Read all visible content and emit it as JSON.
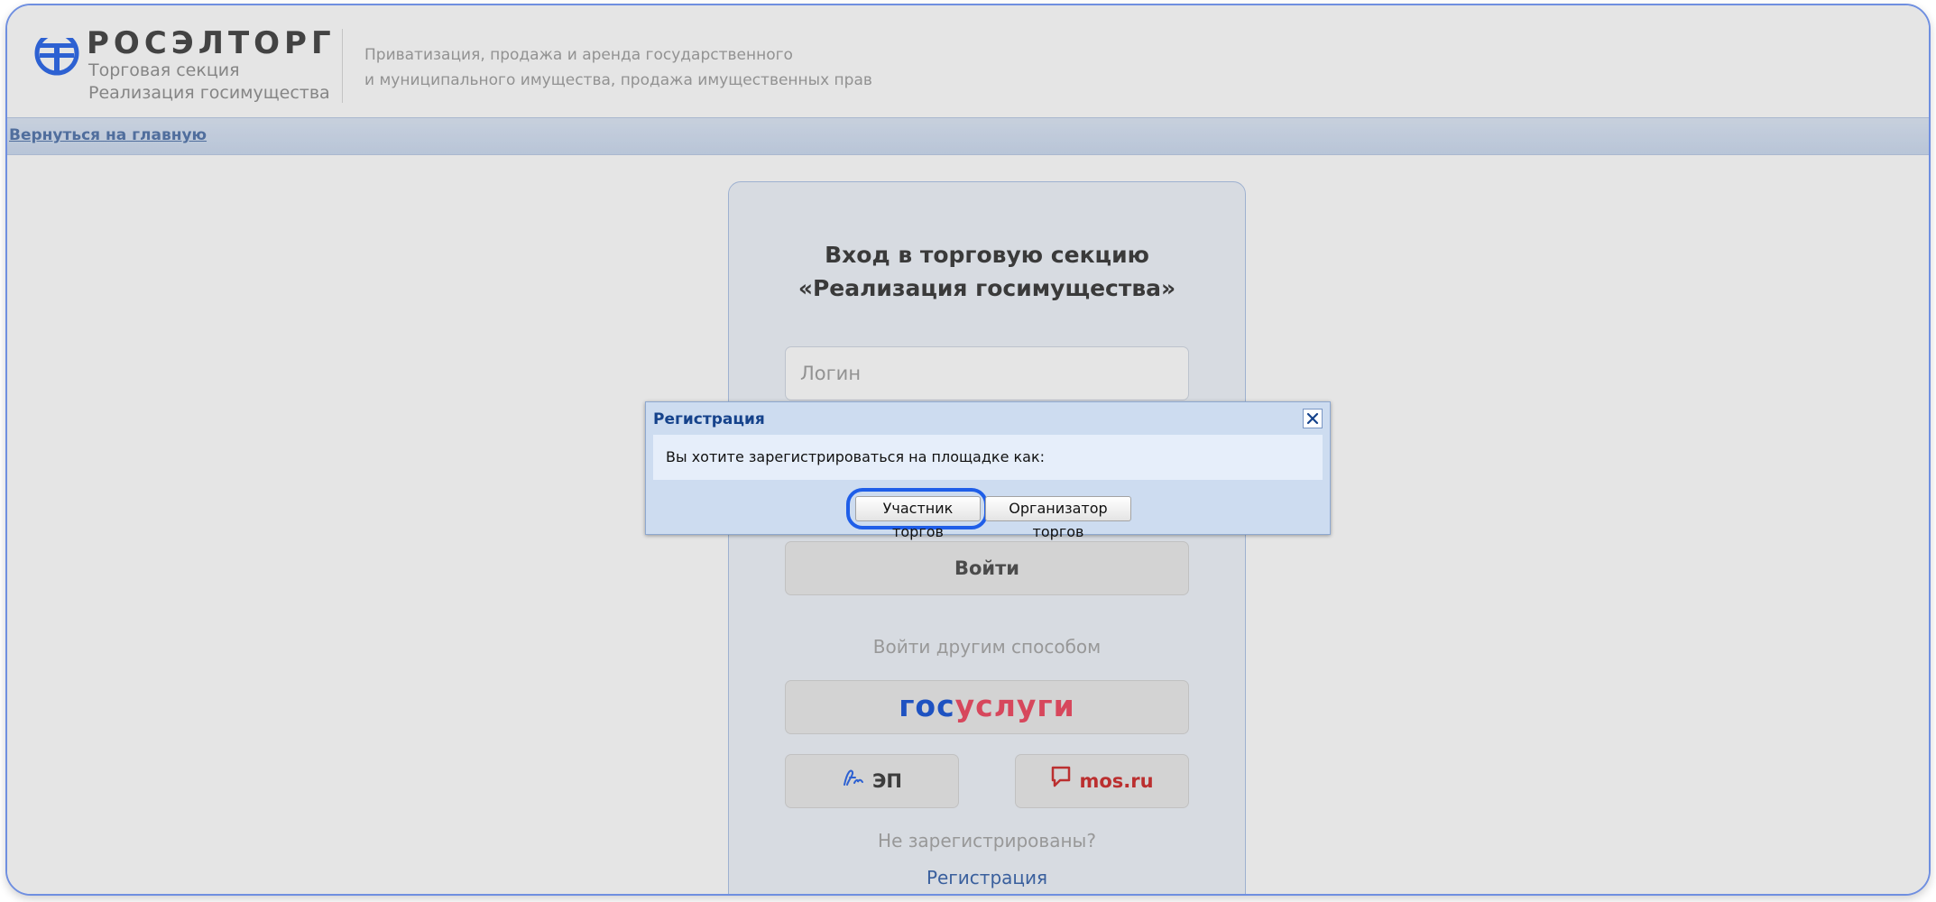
{
  "header": {
    "brand": "РОСЭЛТОРГ",
    "section_line1": "Торговая секция",
    "section_line2": "Реализация госимущества",
    "tagline_line1": "Приватизация, продажа и аренда государственного",
    "tagline_line2": "и муниципального имущества, продажа имущественных прав"
  },
  "nav": {
    "back_link": "Вернуться на главную"
  },
  "login": {
    "title_line1": "Вход в торговую секцию",
    "title_line2": "«Реализация госимущества»",
    "login_placeholder": "Логин",
    "submit_label": "Войти",
    "alt_method_text": "Войти другим способом",
    "gosuslugi_part1": "гос",
    "gosuslugi_part2": "услуги",
    "ep_label": "ЭП",
    "mos_label": "mos.ru",
    "not_registered_text": "Не зарегистрированы?",
    "register_link": "Регистрация"
  },
  "dialog": {
    "title": "Регистрация",
    "question": "Вы хотите зарегистрироваться на площадке как:",
    "participant_button": "Участник торгов",
    "organizer_button": "Организатор торгов"
  },
  "colors": {
    "accent": "#1f5ee8",
    "dialog_title": "#15428b",
    "gos_blue": "#0d4cd3",
    "gos_red": "#ee3f58",
    "mos_red": "#cc2222"
  }
}
